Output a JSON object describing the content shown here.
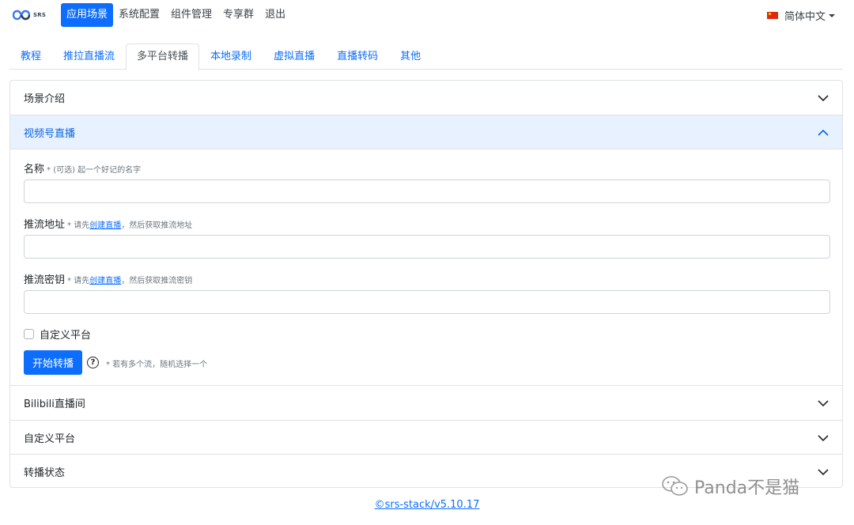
{
  "brand": {
    "logo_text": "SRS"
  },
  "nav": {
    "items": [
      {
        "label": "应用场景",
        "active": true
      },
      {
        "label": "系统配置",
        "active": false
      },
      {
        "label": "组件管理",
        "active": false
      },
      {
        "label": "专享群",
        "active": false
      },
      {
        "label": "退出",
        "active": false
      }
    ],
    "language": "简体中文"
  },
  "tabs": [
    {
      "label": "教程",
      "active": false
    },
    {
      "label": "推拉直播流",
      "active": false
    },
    {
      "label": "多平台转播",
      "active": true
    },
    {
      "label": "本地录制",
      "active": false
    },
    {
      "label": "虚拟直播",
      "active": false
    },
    {
      "label": "直播转码",
      "active": false
    },
    {
      "label": "其他",
      "active": false
    }
  ],
  "accordion": {
    "sections": [
      {
        "title": "场景介绍",
        "open": false
      },
      {
        "title": "视频号直播",
        "open": true
      },
      {
        "title": "Bilibili直播间",
        "open": false
      },
      {
        "title": "自定义平台",
        "open": false
      },
      {
        "title": "转播状态",
        "open": false
      }
    ]
  },
  "form": {
    "name": {
      "label": "名称",
      "hint": "* (可选) 起一个好记的名字",
      "value": ""
    },
    "server": {
      "label": "推流地址",
      "hint_prefix": "* 请先",
      "hint_link": "创建直播",
      "hint_suffix": "，然后获取推流地址",
      "value": ""
    },
    "key": {
      "label": "推流密钥",
      "hint_prefix": "* 请先",
      "hint_link": "创建直播",
      "hint_suffix": "，然后获取推流密钥",
      "value": ""
    },
    "custom_platform": "自定义平台",
    "start_button": "开始转播",
    "help_glyph": "?",
    "button_hint": "* 若有多个流，随机选择一个"
  },
  "footer": {
    "version_link": "©srs-stack/v5.10.17"
  },
  "watermark": {
    "text": "Panda不是猫"
  },
  "colors": {
    "primary": "#0d6efd",
    "open_header_bg": "#e7f1ff",
    "border": "#dee2e6"
  }
}
